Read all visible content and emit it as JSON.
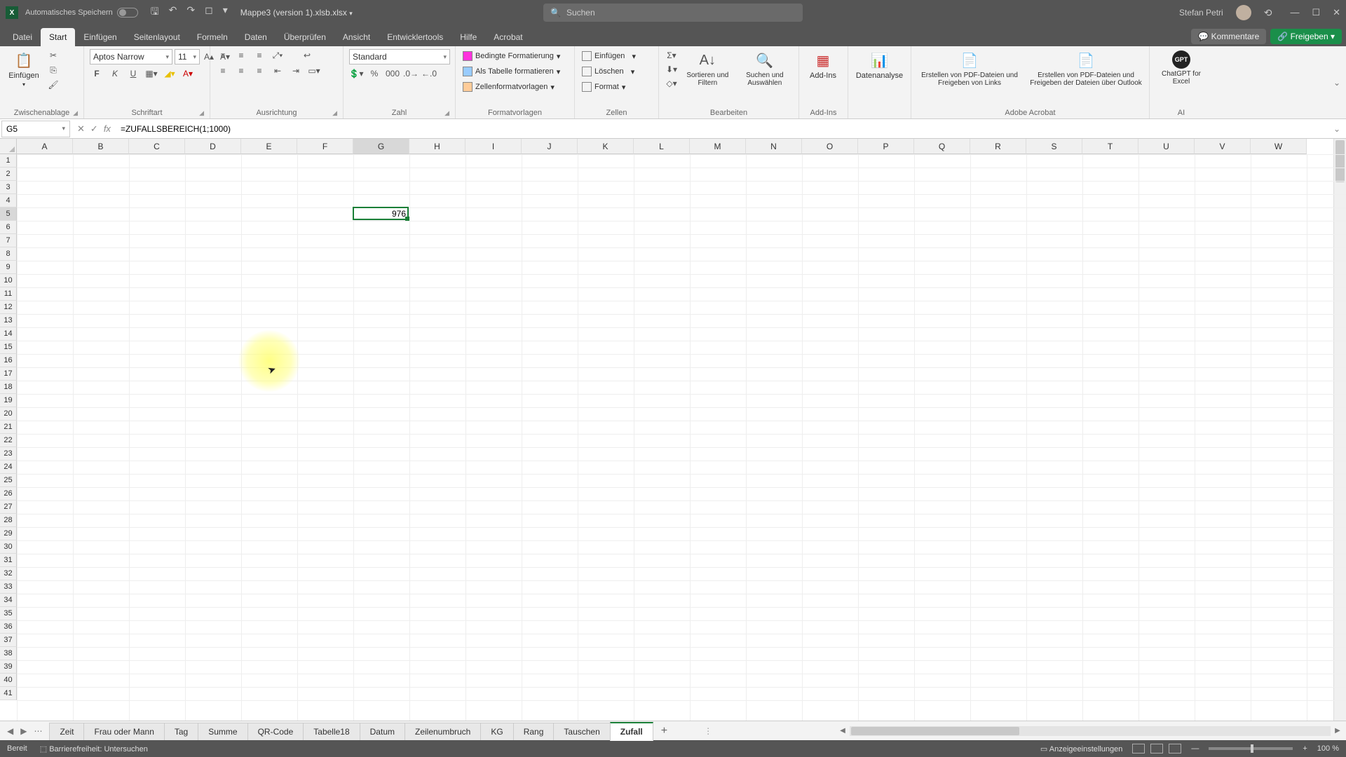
{
  "titlebar": {
    "autosave_label": "Automatisches Speichern",
    "doc_name": "Mappe3 (version 1).xlsb.xlsx",
    "search_placeholder": "Suchen",
    "user_name": "Stefan Petri"
  },
  "tabs": {
    "items": [
      "Datei",
      "Start",
      "Einfügen",
      "Seitenlayout",
      "Formeln",
      "Daten",
      "Überprüfen",
      "Ansicht",
      "Entwicklertools",
      "Hilfe",
      "Acrobat"
    ],
    "active_index": 1,
    "comments": "Kommentare",
    "share": "Freigeben"
  },
  "ribbon": {
    "clipboard": {
      "paste": "Einfügen",
      "group": "Zwischenablage"
    },
    "font": {
      "name": "Aptos Narrow",
      "size": "11",
      "group": "Schriftart",
      "bold": "F",
      "italic": "K",
      "underline": "U"
    },
    "align": {
      "group": "Ausrichtung"
    },
    "number": {
      "format": "Standard",
      "group": "Zahl"
    },
    "styles": {
      "cond": "Bedingte Formatierung",
      "table": "Als Tabelle formatieren",
      "cell": "Zellenformatvorlagen",
      "group": "Formatvorlagen"
    },
    "cells": {
      "insert": "Einfügen",
      "delete": "Löschen",
      "format": "Format",
      "group": "Zellen"
    },
    "editing": {
      "sort": "Sortieren und Filtern",
      "find": "Suchen und Auswählen",
      "group": "Bearbeiten"
    },
    "addins": {
      "addins": "Add-Ins",
      "group": "Add-Ins"
    },
    "analysis": {
      "data": "Datenanalyse"
    },
    "acrobat": {
      "pdf1": "Erstellen von PDF-Dateien und Freigeben von Links",
      "pdf2": "Erstellen von PDF-Dateien und Freigeben der Dateien über Outlook",
      "group": "Adobe Acrobat"
    },
    "ai": {
      "gpt": "ChatGPT for Excel",
      "group": "AI"
    }
  },
  "namebox": "G5",
  "formula": "=ZUFALLSBEREICH(1;1000)",
  "columns": [
    "A",
    "B",
    "C",
    "D",
    "E",
    "F",
    "G",
    "H",
    "I",
    "J",
    "K",
    "L",
    "M",
    "N",
    "O",
    "P",
    "Q",
    "R",
    "S",
    "T",
    "U",
    "V",
    "W"
  ],
  "rows_count": 41,
  "active_cell": {
    "col": 6,
    "row": 4,
    "value": "976"
  },
  "highlight": {
    "col": 4,
    "row": 15
  },
  "sheet_tabs": {
    "items": [
      "Zeit",
      "Frau oder Mann",
      "Tag",
      "Summe",
      "QR-Code",
      "Tabelle18",
      "Datum",
      "Zeilenumbruch",
      "KG",
      "Rang",
      "Tauschen",
      "Zufall"
    ],
    "active_index": 11
  },
  "status": {
    "ready": "Bereit",
    "access": "Barrierefreiheit: Untersuchen",
    "display": "Anzeigeeinstellungen",
    "zoom": "100 %"
  }
}
